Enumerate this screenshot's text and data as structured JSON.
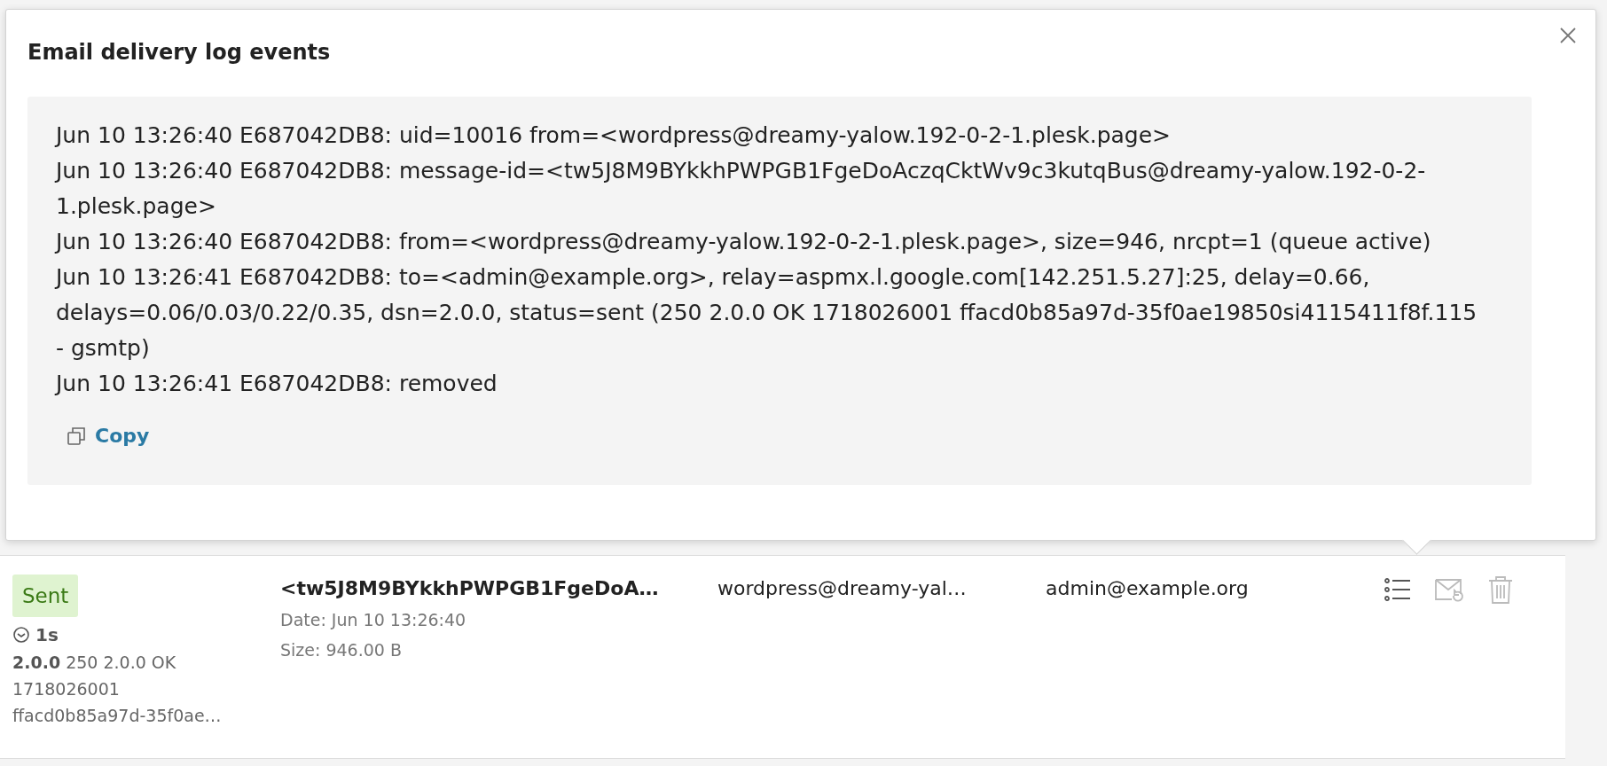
{
  "dialog": {
    "title": "Email delivery log events",
    "log_lines": [
      "Jun 10 13:26:40 E687042DB8: uid=10016 from=<wordpress@dreamy-yalow.192-0-2-1.plesk.page>",
      "Jun 10 13:26:40 E687042DB8: message-id=<tw5J8M9BYkkhPWPGB1FgeDoAczqCktWv9c3kutqBus@dreamy-yalow.192-0-2-1.plesk.page>",
      "Jun 10 13:26:40 E687042DB8: from=<wordpress@dreamy-yalow.192-0-2-1.plesk.page>, size=946, nrcpt=1 (queue active)",
      "Jun 10 13:26:41 E687042DB8: to=<admin@example.org>, relay=aspmx.l.google.com[142.251.5.27]:25, delay=0.66, delays=0.06/0.03/0.22/0.35, dsn=2.0.0, status=sent (250 2.0.0 OK 1718026001 ffacd0b85a97d-35f0ae19850si4115411f8f.115 - gsmtp)",
      "Jun 10 13:26:41 E687042DB8: removed"
    ],
    "copy_label": "Copy"
  },
  "message_row": {
    "status": "Sent",
    "duration": "1s",
    "dsn": "2.0.0",
    "response": "250 2.0.0 OK 1718026001 ffacd0b85a97d-35f0ae…",
    "message_id": "<tw5J8M9BYkkhPWPGB1FgeDoA…",
    "date": "Date: Jun 10 13:26:40",
    "size": "Size: 946.00 B",
    "from": "wordpress@dreamy-yal…",
    "to": "admin@example.org",
    "actions": [
      {
        "kind": "log",
        "disabled": false
      },
      {
        "kind": "resend",
        "disabled": true
      },
      {
        "kind": "delete",
        "disabled": true
      }
    ]
  }
}
